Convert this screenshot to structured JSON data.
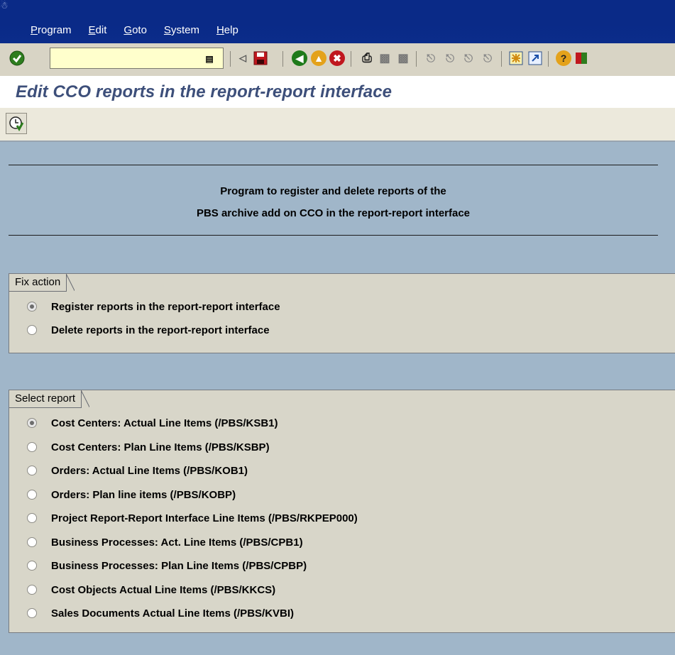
{
  "menu": {
    "items": [
      "Program",
      "Edit",
      "Goto",
      "System",
      "Help"
    ]
  },
  "toolbar": {
    "command_value": "",
    "icons": [
      "enter-check-icon",
      "command-dropdown-icon",
      "collapse-arrow-icon",
      "save-icon",
      "back-icon",
      "exit-icon",
      "cancel-icon",
      "print-icon",
      "find-icon",
      "find-next-icon",
      "first-page-icon",
      "previous-page-icon",
      "next-page-icon",
      "last-page-icon",
      "create-session-icon",
      "shortcut-icon",
      "help-icon",
      "layout-icon"
    ]
  },
  "page": {
    "title": "Edit CCO reports in the report-report interface"
  },
  "description": {
    "line1": "Program to register and delete reports of the",
    "line2": "PBS archive add on CCO in the report-report interface"
  },
  "fix_action": {
    "title": "Fix action",
    "options": [
      {
        "label": "Register reports in the report-report interface",
        "selected": true
      },
      {
        "label": "Delete reports in the report-report interface",
        "selected": false
      }
    ]
  },
  "select_report": {
    "title": "Select report",
    "options": [
      {
        "label": "Cost Centers: Actual Line Items (/PBS/KSB1)",
        "selected": true
      },
      {
        "label": "Cost Centers: Plan Line Items (/PBS/KSBP)",
        "selected": false
      },
      {
        "label": "Orders: Actual Line Items (/PBS/KOB1)",
        "selected": false
      },
      {
        "label": "Orders: Plan line items (/PBS/KOBP)",
        "selected": false
      },
      {
        "label": "Project Report-Report Interface Line Items (/PBS/RKPEP000)",
        "selected": false
      },
      {
        "label": "Business Processes: Act. Line Items (/PBS/CPB1)",
        "selected": false
      },
      {
        "label": "Business Processes: Plan Line Items (/PBS/CPBP)",
        "selected": false
      },
      {
        "label": "Cost Objects Actual Line Items (/PBS/KKCS)",
        "selected": false
      },
      {
        "label": "Sales Documents Actual Line Items (/PBS/KVBI)",
        "selected": false
      }
    ]
  },
  "colors": {
    "menubar": "#0a2a87",
    "title_text": "#3d4f7a",
    "content_bg": "#a0b6c9",
    "group_bg": "#d8d6c9",
    "command_field": "#ffffcc"
  }
}
